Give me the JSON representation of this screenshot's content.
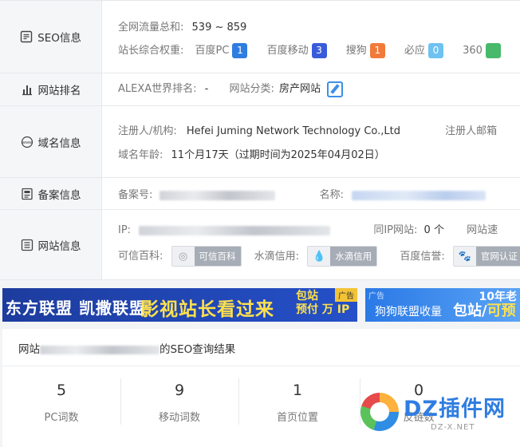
{
  "seo": {
    "label": "SEO信息",
    "traffic_key": "全网流量总和:",
    "traffic_value": "539 ~ 859",
    "weight_key": "站长综合权重:",
    "weights": [
      {
        "name": "百度PC",
        "value": "1",
        "color": "#2f7de1"
      },
      {
        "name": "百度移动",
        "value": "3",
        "color": "#3a5bd9"
      },
      {
        "name": "搜狗",
        "value": "1",
        "color": "#f17a3b"
      },
      {
        "name": "必应",
        "value": "0",
        "color": "#6ec2f2"
      },
      {
        "name": "360",
        "value": "",
        "color": "#48b96b"
      }
    ]
  },
  "rank": {
    "label": "网站排名",
    "alexa_key": "ALEXA世界排名:",
    "alexa_value": "-",
    "category_key": "网站分类:",
    "category_value": "房产网站"
  },
  "domain": {
    "label": "域名信息",
    "registrant_key": "注册人/机构:",
    "registrant_value": "Hefei Juming Network Technology Co.,Ltd",
    "email_key": "注册人邮箱",
    "age_key": "域名年龄:",
    "age_value": "11个月17天（过期时间为2025年04月02日）"
  },
  "icp": {
    "label": "备案信息",
    "number_key": "备案号:",
    "name_key": "名称:"
  },
  "site": {
    "label": "网站信息",
    "ip_key": "IP:",
    "same_ip_key": "同IP网站:",
    "same_ip_value": "0 个",
    "speed_key": "网站速",
    "kexin_key": "可信百科:",
    "kexin_badge": "可信百科",
    "shuidi_key": "水滴信用:",
    "shuidi_badge": "水滴信用",
    "baidu_key": "百度信誉:",
    "baidu_badge": "官网认证"
  },
  "ads": {
    "ad1_left": "东方联盟 凯撒联盟",
    "ad1_main": "影视站长看过来",
    "ad1_right_1": "包站",
    "ad1_right_2": "预付 万 IP",
    "ad1_tag": "广告",
    "ad2_tag": "广告",
    "ad2_left": "狗狗联盟收量",
    "ad2_main_1": "包站/",
    "ad2_main_2": "可预",
    "ad2_top": "10年老"
  },
  "result": {
    "title_prefix": "网站",
    "title_suffix": "的SEO查询结果",
    "stats": [
      {
        "value": "5",
        "label": "PC词数"
      },
      {
        "value": "9",
        "label": "移动词数"
      },
      {
        "value": "1",
        "label": "首页位置"
      },
      {
        "value": "0",
        "label": "反链数"
      }
    ]
  },
  "watermark": {
    "text": "DZ插件网",
    "sub": "DZ-X.NET"
  }
}
